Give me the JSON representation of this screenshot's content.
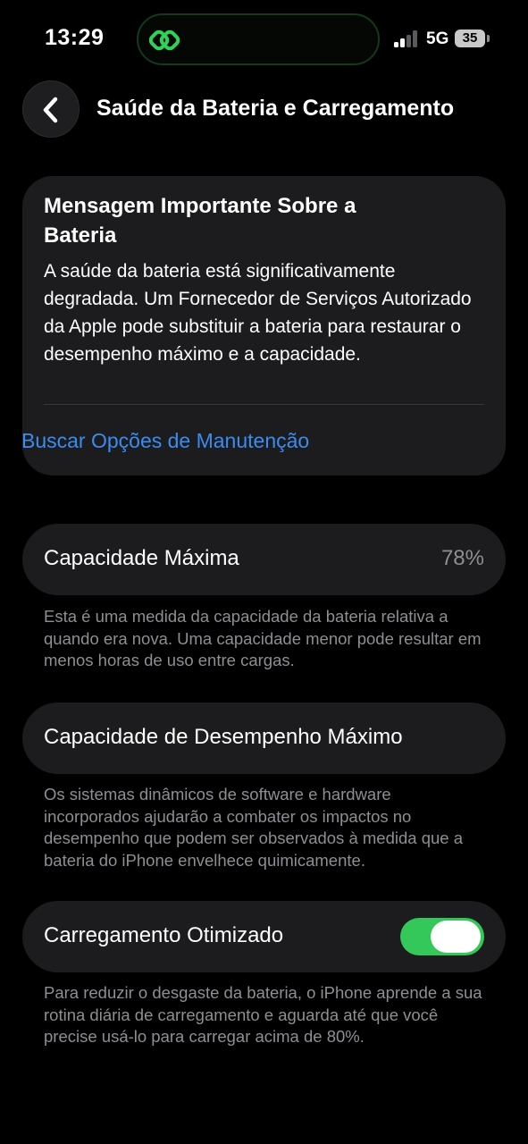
{
  "status_bar": {
    "time": "13:29",
    "network": "5G",
    "battery_level": "35",
    "island_icon": "link-activity-icon",
    "accent_green": "#2fd158"
  },
  "header": {
    "back_icon": "chevron-left-icon",
    "title": "Saúde da Bateria e Carregamento"
  },
  "message_card": {
    "heading": "Mensagem Importante Sobre a Bateria",
    "body": "A saúde da bateria está significativamente degradada. Um Fornecedor de Serviços Autorizado da Apple pode substituir a bateria para restaurar o desempenho máximo e a capacidade.",
    "link": "Buscar Opções de Manutenção",
    "link_color": "#3a8cf0"
  },
  "max_capacity": {
    "label": "Capacidade Máxima",
    "value": "78%",
    "footnote": "Esta é uma medida da capacidade da bateria relativa a quando era nova. Uma capacidade menor pode resultar em menos horas de uso entre cargas."
  },
  "peak_performance": {
    "label": "Capacidade de Desempenho Máximo",
    "footnote": "Os sistemas dinâmicos de software e hardware incorporados ajudarão a combater os impactos no desempenho que podem ser observados à medida que a bateria do iPhone envelhece quimicamente."
  },
  "optimized_charging": {
    "label": "Carregamento Otimizado",
    "enabled": true,
    "toggle_color": "#34c759",
    "footnote": "Para reduzir o desgaste da bateria, o iPhone aprende a sua rotina diária de carregamento e aguarda até que você precise usá-lo para carregar acima de 80%."
  }
}
